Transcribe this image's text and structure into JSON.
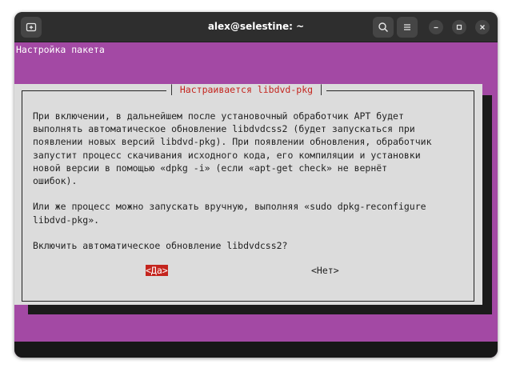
{
  "window": {
    "title": "alex@selestine: ~"
  },
  "titlebar": {
    "new_tab_icon": "new-tab-icon",
    "search_icon": "search-icon",
    "menu_icon": "hamburger-menu-icon",
    "minimize_icon": "minimize-icon",
    "maximize_icon": "maximize-icon",
    "close_icon": "close-icon"
  },
  "terminal": {
    "header": "Настройка пакета",
    "background_color": "#a349a4"
  },
  "dialog": {
    "title": "Настраивается libdvd-pkg",
    "title_color": "#c4251e",
    "body_lines": [
      "При включении, в дальнейшем после установочный обработчик APT будет",
      "выполнять автоматическое обновление libdvdcss2 (будет запускаться при",
      "появлении новых версий libdvd-pkg). При появлении обновления, обработчик",
      "запустит процесс скачивания исходного кода, его компиляции и установки",
      "новой версии в помощью «dpkg -i» (если «apt-get check» не вернёт",
      "ошибок).",
      "",
      "Или же процесс можно запускать вручную, выполняя «sudo dpkg-reconfigure",
      "libdvd-pkg».",
      "",
      "Включить автоматическое обновление libdvdcss2?"
    ],
    "yes_label": "<Да>",
    "no_label": "<Нет>"
  }
}
